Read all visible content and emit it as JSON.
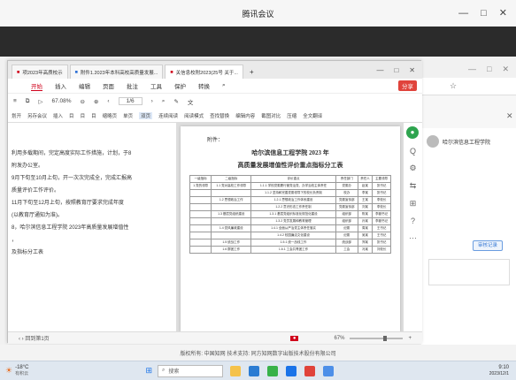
{
  "meeting": {
    "title": "腾讯会议",
    "controls": [
      "—",
      "□",
      "✕"
    ]
  },
  "browser": {
    "tabs": [
      {
        "label": "哈尔滨信息 · 高校高质量发展评价..."
      },
      {
        "label": "新标签页"
      }
    ],
    "controls": [
      "—",
      "□",
      "✕"
    ],
    "profile": "哈尔滨信息工程学院",
    "right_btn": "审核记录"
  },
  "wps": {
    "tabs": [
      "项2023年高质校示",
      "附件1.2023年本科高校高质量发展...",
      "关信息校附2023(25号 关于...",
      "+"
    ],
    "window_controls": [
      "—",
      "□",
      "✕"
    ],
    "menu": [
      "开始",
      "插入",
      "编辑",
      "页面",
      "批注",
      "工具",
      "保护",
      "转换"
    ],
    "share_btn": "分享",
    "zoom": "67.08%",
    "page_indicator": "1/6",
    "tool2": [
      "划开",
      "另存会议",
      "插入",
      "目",
      "目",
      "目",
      "缩略页",
      "单页",
      "双页",
      "连续阅读",
      "阅读模式",
      "查找替换",
      "编辑内容",
      "截图对比",
      "压缩",
      "全文翻译"
    ],
    "left_lines": [
      "利用多载期间，完定高度实际工作措施，计划，于8",
      "附发办公室。",
      "9月下旬至10月上旬，开一次次完成全，完成汇报高",
      "质量评价工作评价。",
      "11月下旬至12月上旬，按照教育厅要求完成年度",
      "(以教育厅通知为准)。",
      "",
      "8，哈尔滨信息工程学院 2023年高质量发展增值性",
      "，",
      "及指标分工表"
    ],
    "page": {
      "attach": "附件：",
      "title1": "哈尔滨信息工程学院 2023 年",
      "title2": "高质量发展增值性评价重点指标分工表",
      "headers": [
        "一级指标",
        "二级指标",
        "评价重点",
        "责任部门",
        "责任人",
        "主要领导"
      ],
      "rows": [
        [
          "1.党的领导",
          "1.1 党对高校工作领导",
          "1.1.1 学校党委履行管党治党、办学治校主体责任",
          "党委办",
          "赵某",
          "张书记"
        ],
        [
          "",
          "",
          "1.1.2 坚持和完善党委领导下的校长负责制",
          "校办",
          "李某",
          "张书记"
        ],
        [
          "",
          "1.2 思想政治工作",
          "1.2.1 思想政治工作体系建设",
          "党委宣传部",
          "王某",
          "李校长"
        ],
        [
          "",
          "",
          "1.2.2 意识形态工作责任制",
          "党委宣传部",
          "刘某",
          "李校长"
        ],
        [
          "",
          "1.3 基层党组织建设",
          "1.3.1 基层党组织标准化规范化建设",
          "组织部",
          "陈某",
          "李副书记"
        ],
        [
          "",
          "",
          "1.3.2 党员发展和教育管理",
          "组织部",
          "孙某",
          "李副书记"
        ],
        [
          "",
          "1.4 党风廉政建设",
          "1.4.1 全面从严治党主体责任落实",
          "纪委",
          "周某",
          "王书记"
        ],
        [
          "",
          "",
          "1.4.2 校园廉洁文化建设",
          "纪委",
          "吴某",
          "王书记"
        ],
        [
          "",
          "1.5 统战工作",
          "1.5.1 统一战线工作",
          "统战部",
          "郑某",
          "张书记"
        ],
        [
          "",
          "1.6 群团工作",
          "1.6.1 工会共青团工作",
          "工会",
          "冯某",
          "刘校长"
        ]
      ]
    },
    "sidebar_icons": [
      "Q",
      "⚙",
      "⇆",
      "⊞",
      "?",
      "···"
    ],
    "status": {
      "left": "‹ › 回到第1页",
      "zoom": "67%",
      "plus": "+"
    }
  },
  "caption": "版权所有: 中国知网  技术支持: 同方知网数字出版技术股份有限公司",
  "taskbar": {
    "weather": "-18°C",
    "weather_sub": "有积云",
    "search": "搜索",
    "time": "9:10",
    "date": "2023/12/1"
  }
}
